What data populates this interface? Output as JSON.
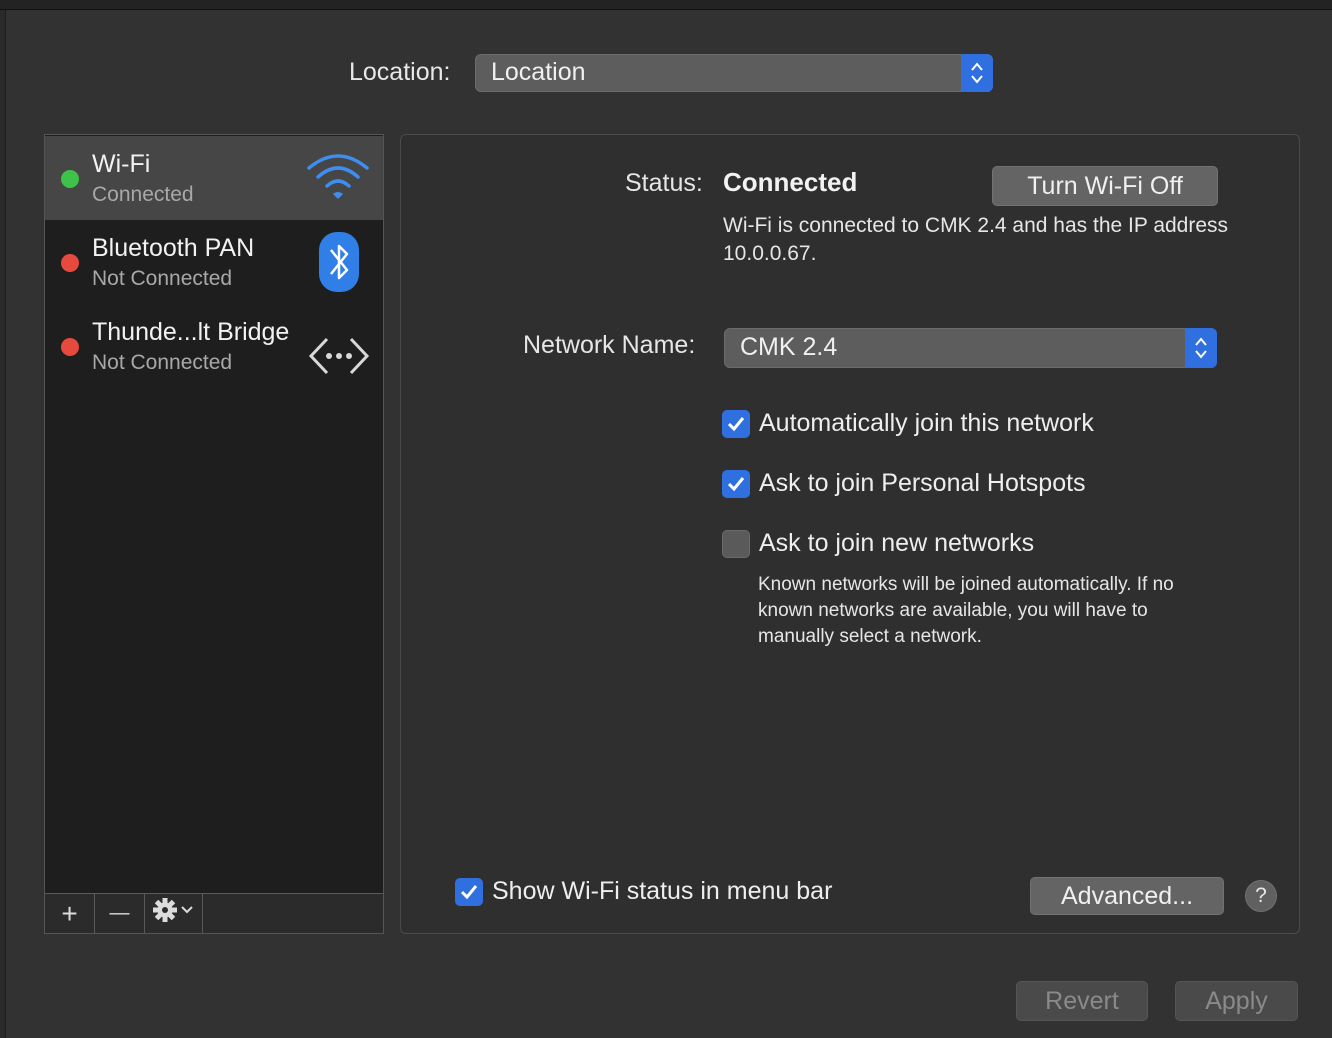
{
  "location": {
    "label": "Location:",
    "value": "Location"
  },
  "services": [
    {
      "name": "Wi-Fi",
      "state": "Connected",
      "status_color": "#3fc24a",
      "icon": "wifi-icon",
      "selected": true
    },
    {
      "name": "Bluetooth PAN",
      "state": "Not Connected",
      "status_color": "#e64a3f",
      "icon": "bluetooth-icon",
      "selected": false
    },
    {
      "name": "Thunde...lt Bridge",
      "state": "Not Connected",
      "status_color": "#e64a3f",
      "icon": "thunderbolt-bridge-icon",
      "selected": false
    }
  ],
  "sidebar_toolbar": {
    "add": "+",
    "remove": "—",
    "gear": "gear-icon"
  },
  "status": {
    "label": "Status:",
    "value": "Connected",
    "description": "Wi-Fi is connected to CMK 2.4 and has the IP address 10.0.0.67.",
    "turn_off_label": "Turn Wi-Fi Off"
  },
  "network": {
    "label": "Network Name:",
    "value": "CMK 2.4"
  },
  "options": [
    {
      "label": "Automatically join this network",
      "checked": true
    },
    {
      "label": "Ask to join Personal Hotspots",
      "checked": true
    },
    {
      "label": "Ask to join new networks",
      "checked": false
    }
  ],
  "note": "Known networks will be joined automatically. If no known networks are available, you will have to manually select a network.",
  "menubar_option": {
    "label": "Show Wi-Fi status in menu bar",
    "checked": true
  },
  "advanced_label": "Advanced...",
  "help_label": "?",
  "footer": {
    "revert_label": "Revert",
    "apply_label": "Apply"
  },
  "colors": {
    "accent": "#2f6fe0",
    "connected": "#3fc24a",
    "disconnected": "#e64a3f"
  }
}
